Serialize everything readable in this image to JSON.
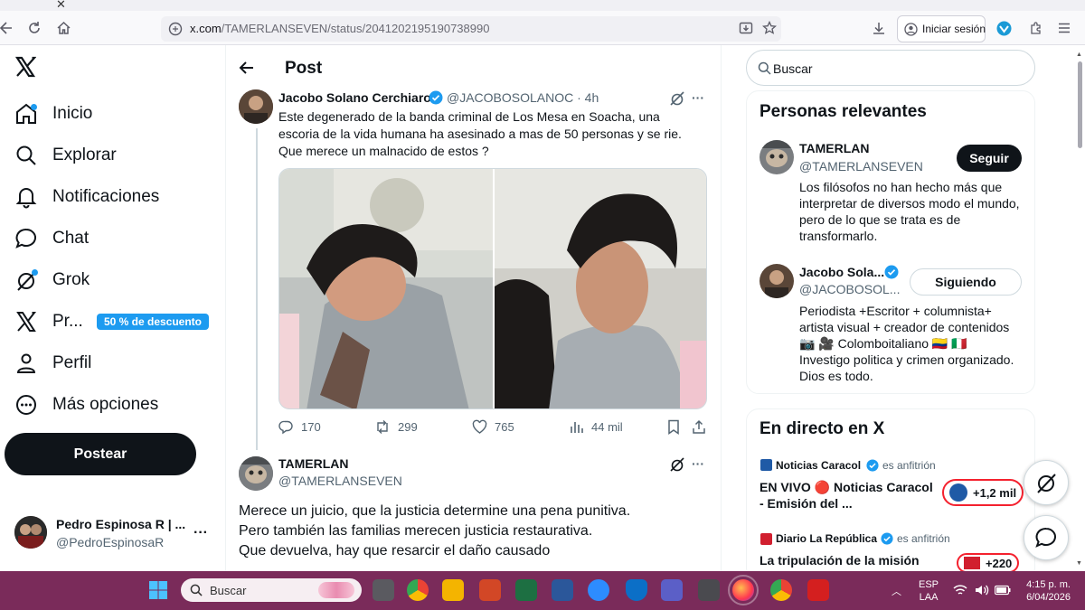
{
  "browser": {
    "url_host": "x.com",
    "url_path": "/TAMERLANSEVEN/status/2041202195190738990",
    "signin_label": "Iniciar sesión",
    "accent": "#0060df"
  },
  "sidebar": {
    "items": [
      {
        "label": "Inicio"
      },
      {
        "label": "Explorar"
      },
      {
        "label": "Notificaciones"
      },
      {
        "label": "Chat"
      },
      {
        "label": "Grok"
      },
      {
        "label": "Pr..."
      },
      {
        "label": "Perfil"
      },
      {
        "label": "Más opciones"
      }
    ],
    "promo_badge": "50 % de descuento",
    "post_button": "Postear",
    "account": {
      "name": "Pedro Espinosa R | ...",
      "handle": "@PedroEspinosaR"
    }
  },
  "main": {
    "header_title": "Post",
    "tweet": {
      "author_name": "Jacobo Solano Cerchiaro",
      "handle_time": "@JACOBOSOLANOC · 4h",
      "text": "Este degenerado de la banda criminal de Los Mesa en Soacha, una escoria de la vida humana ha asesinado a mas de 50 personas y se rie. Que merece un malnacido de estos ?",
      "stats": {
        "replies": "170",
        "reposts": "299",
        "likes": "765",
        "views": "44 mil"
      }
    },
    "reply": {
      "author_name": "TAMERLAN",
      "handle": "@TAMERLANSEVEN",
      "line1": "Merece un juicio,  que la justicia determine una pena punitiva.",
      "line2": "Pero también las familias merecen justicia restaurativa.",
      "line3": "Que devuelva,  hay que resarcir el daño causado"
    }
  },
  "right": {
    "search_placeholder": "Buscar",
    "relevant": {
      "title": "Personas relevantes",
      "people": [
        {
          "name": "TAMERLAN",
          "handle": "@TAMERLANSEVEN",
          "button": "Seguir",
          "bio": "Los filósofos no han hecho más que interpretar de diversos modo el mundo, pero de lo que se trata es de transformarlo."
        },
        {
          "name": "Jacobo Sola...",
          "handle": "@JACOBOSOL...",
          "button": "Siguiendo",
          "bio_line1": "Periodista +Escritor + columnista+ artista visual + creador de contenidos",
          "bio_line2": "📷 🎥 Colomboitaliano 🇨🇴 🇮🇹",
          "bio_line3": "Investigo politica y crimen organizado. Dios es todo."
        }
      ]
    },
    "live": {
      "title": "En directo en X",
      "items": [
        {
          "source": "Noticias Caracol",
          "host": "es anfitrión",
          "title": "EN VIVO 🔴 Noticias Caracol - Emisión del ...",
          "listeners": "+1,2 mil"
        },
        {
          "source": "Diario La República",
          "host": "es anfitrión",
          "title": "La tripulación de la misión",
          "listeners": "+220"
        }
      ]
    }
  },
  "taskbar": {
    "search": "Buscar",
    "lang1": "ESP",
    "lang2": "LAA",
    "time": "4:15 p. m.",
    "date": "6/04/2026"
  }
}
